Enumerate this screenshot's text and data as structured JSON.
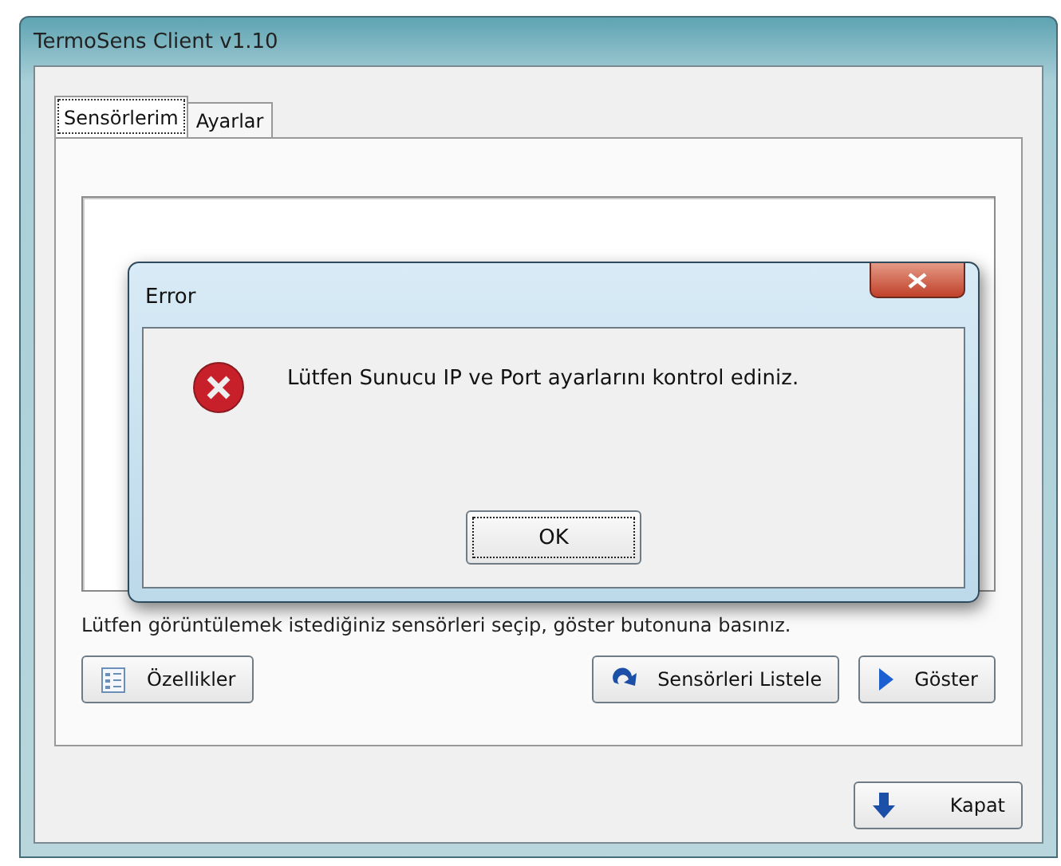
{
  "window": {
    "title": "TermoSens Client v1.10"
  },
  "tabs": [
    {
      "label": "Sensörlerim",
      "selected": true
    },
    {
      "label": "Ayarlar",
      "selected": false
    }
  ],
  "hint": "Lütfen görüntülemek istediğiniz sensörleri seçip, göster butonuna basınız.",
  "left_buttons": [
    {
      "label": "Özellikler",
      "kind": "list"
    }
  ],
  "right_buttons": [
    {
      "label": "Sensörleri Listele",
      "kind": "refresh"
    },
    {
      "label": "Göster",
      "kind": "play"
    }
  ],
  "footer_buttons": [
    {
      "label": "Kapat",
      "kind": "down"
    }
  ],
  "dialog": {
    "title": "Error",
    "message": "Lütfen Sunucu IP ve Port ayarlarını kontrol ediniz.",
    "button": "OK"
  }
}
